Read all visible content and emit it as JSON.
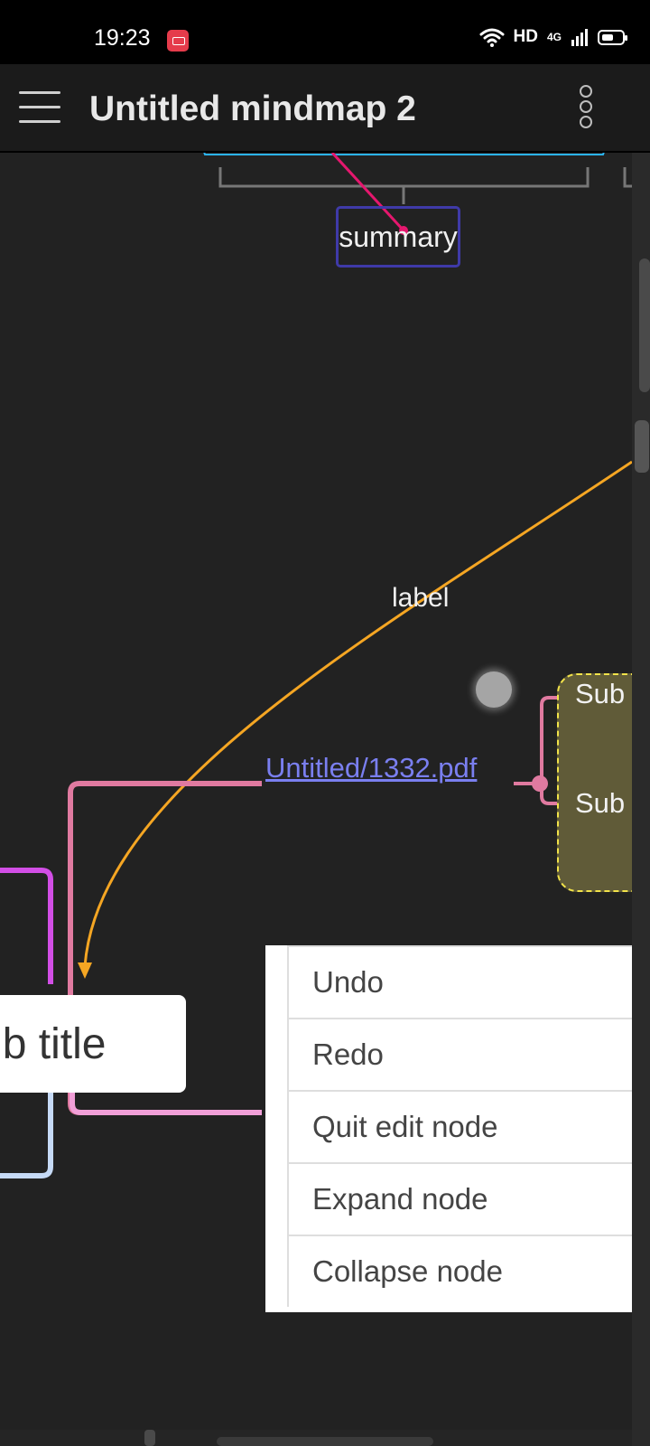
{
  "status_bar": {
    "time": "19:23",
    "hd_label": "HD",
    "network_label": "4G",
    "icons": [
      "screen-record-icon",
      "wifi-icon",
      "signal-icon",
      "battery-icon"
    ]
  },
  "app_bar": {
    "title": "Untitled mindmap 2",
    "icons": [
      "hamburger-menu-icon",
      "overflow-menu-icon"
    ]
  },
  "mindmap": {
    "summary_node": "summary",
    "edge_label": "label",
    "link_node": "Untitled/1332.pdf",
    "sub_nodes": [
      "Sub",
      "Sub"
    ],
    "sub_title_node": "ub title",
    "colors": {
      "summary_border": "#3f3aa8",
      "link_text": "#7a7ff0",
      "branch_pink": "#e07aa0",
      "arrow_orange": "#f5a623",
      "sub_box_fill": "#605b38",
      "sub_box_border": "#f2e34a"
    }
  },
  "context_menu": {
    "items": [
      "Undo",
      "Redo",
      "Quit edit node",
      "Expand node",
      "Collapse node"
    ]
  }
}
